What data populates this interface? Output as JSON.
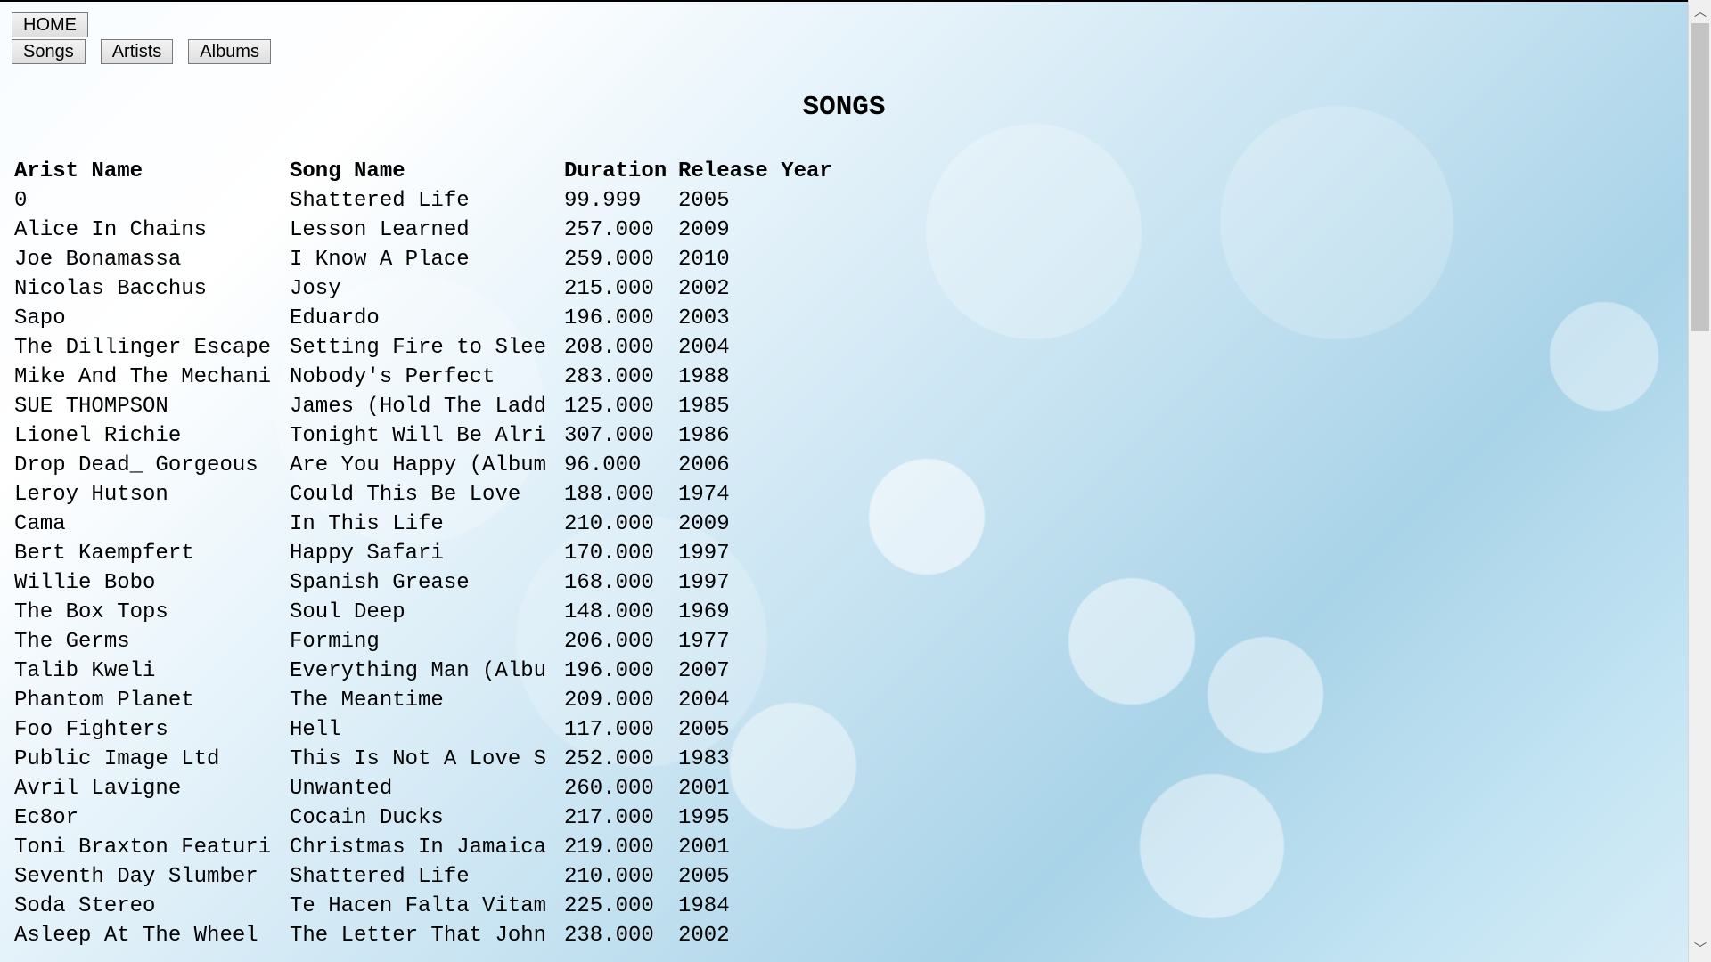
{
  "nav": {
    "home_label": "HOME",
    "songs_label": "Songs",
    "artists_label": "Artists",
    "albums_label": "Albums"
  },
  "page": {
    "title": "SONGS"
  },
  "table": {
    "headers": {
      "artist": "Arist Name",
      "song": "Song Name",
      "duration": "Duration",
      "year": "Release Year"
    },
    "rows": [
      {
        "artist": "0",
        "song": "Shattered Life",
        "duration": "99.999",
        "year": "2005"
      },
      {
        "artist": "Alice In Chains",
        "song": "Lesson Learned",
        "duration": "257.000",
        "year": "2009"
      },
      {
        "artist": "Joe Bonamassa",
        "song": "I Know A Place",
        "duration": "259.000",
        "year": "2010"
      },
      {
        "artist": "Nicolas Bacchus",
        "song": "Josy",
        "duration": "215.000",
        "year": "2002"
      },
      {
        "artist": "Sapo",
        "song": "Eduardo",
        "duration": "196.000",
        "year": "2003"
      },
      {
        "artist": "The Dillinger Escape",
        "song": "Setting Fire to Slee",
        "duration": "208.000",
        "year": "2004"
      },
      {
        "artist": "Mike And The Mechani",
        "song": "Nobody's Perfect",
        "duration": "283.000",
        "year": "1988"
      },
      {
        "artist": "SUE THOMPSON",
        "song": "James (Hold The Ladd",
        "duration": "125.000",
        "year": "1985"
      },
      {
        "artist": "Lionel Richie",
        "song": "Tonight Will Be Alri",
        "duration": "307.000",
        "year": "1986"
      },
      {
        "artist": "Drop Dead_ Gorgeous",
        "song": "Are You Happy (Album",
        "duration": "96.000",
        "year": "2006"
      },
      {
        "artist": "Leroy Hutson",
        "song": "Could This Be Love",
        "duration": "188.000",
        "year": "1974"
      },
      {
        "artist": "Cama",
        "song": "In This Life",
        "duration": "210.000",
        "year": "2009"
      },
      {
        "artist": "Bert Kaempfert",
        "song": "Happy Safari",
        "duration": "170.000",
        "year": "1997"
      },
      {
        "artist": "Willie Bobo",
        "song": "Spanish Grease",
        "duration": "168.000",
        "year": "1997"
      },
      {
        "artist": "The Box Tops",
        "song": "Soul Deep",
        "duration": "148.000",
        "year": "1969"
      },
      {
        "artist": "The Germs",
        "song": "Forming",
        "duration": "206.000",
        "year": "1977"
      },
      {
        "artist": "Talib Kweli",
        "song": "Everything Man (Albu",
        "duration": "196.000",
        "year": "2007"
      },
      {
        "artist": "Phantom Planet",
        "song": "The Meantime",
        "duration": "209.000",
        "year": "2004"
      },
      {
        "artist": "Foo Fighters",
        "song": "Hell",
        "duration": "117.000",
        "year": "2005"
      },
      {
        "artist": "Public Image Ltd",
        "song": "This Is Not A Love S",
        "duration": "252.000",
        "year": "1983"
      },
      {
        "artist": "Avril Lavigne",
        "song": "Unwanted",
        "duration": "260.000",
        "year": "2001"
      },
      {
        "artist": "Ec8or",
        "song": "Cocain Ducks",
        "duration": "217.000",
        "year": "1995"
      },
      {
        "artist": "Toni Braxton Featuri",
        "song": "Christmas In Jamaica",
        "duration": "219.000",
        "year": "2001"
      },
      {
        "artist": "Seventh Day Slumber",
        "song": "Shattered Life",
        "duration": "210.000",
        "year": "2005"
      },
      {
        "artist": "Soda Stereo",
        "song": "Te Hacen Falta Vitam",
        "duration": "225.000",
        "year": "1984"
      },
      {
        "artist": "Asleep At The Wheel",
        "song": "The Letter That John",
        "duration": "238.000",
        "year": "2002"
      }
    ]
  },
  "icons": {
    "scroll_up": "scroll-up-arrow-icon",
    "scroll_down": "scroll-down-arrow-icon"
  },
  "colors": {
    "text": "#000000",
    "scrollbar_track": "#f0f0f0",
    "scrollbar_thumb": "#c4c4c4"
  }
}
